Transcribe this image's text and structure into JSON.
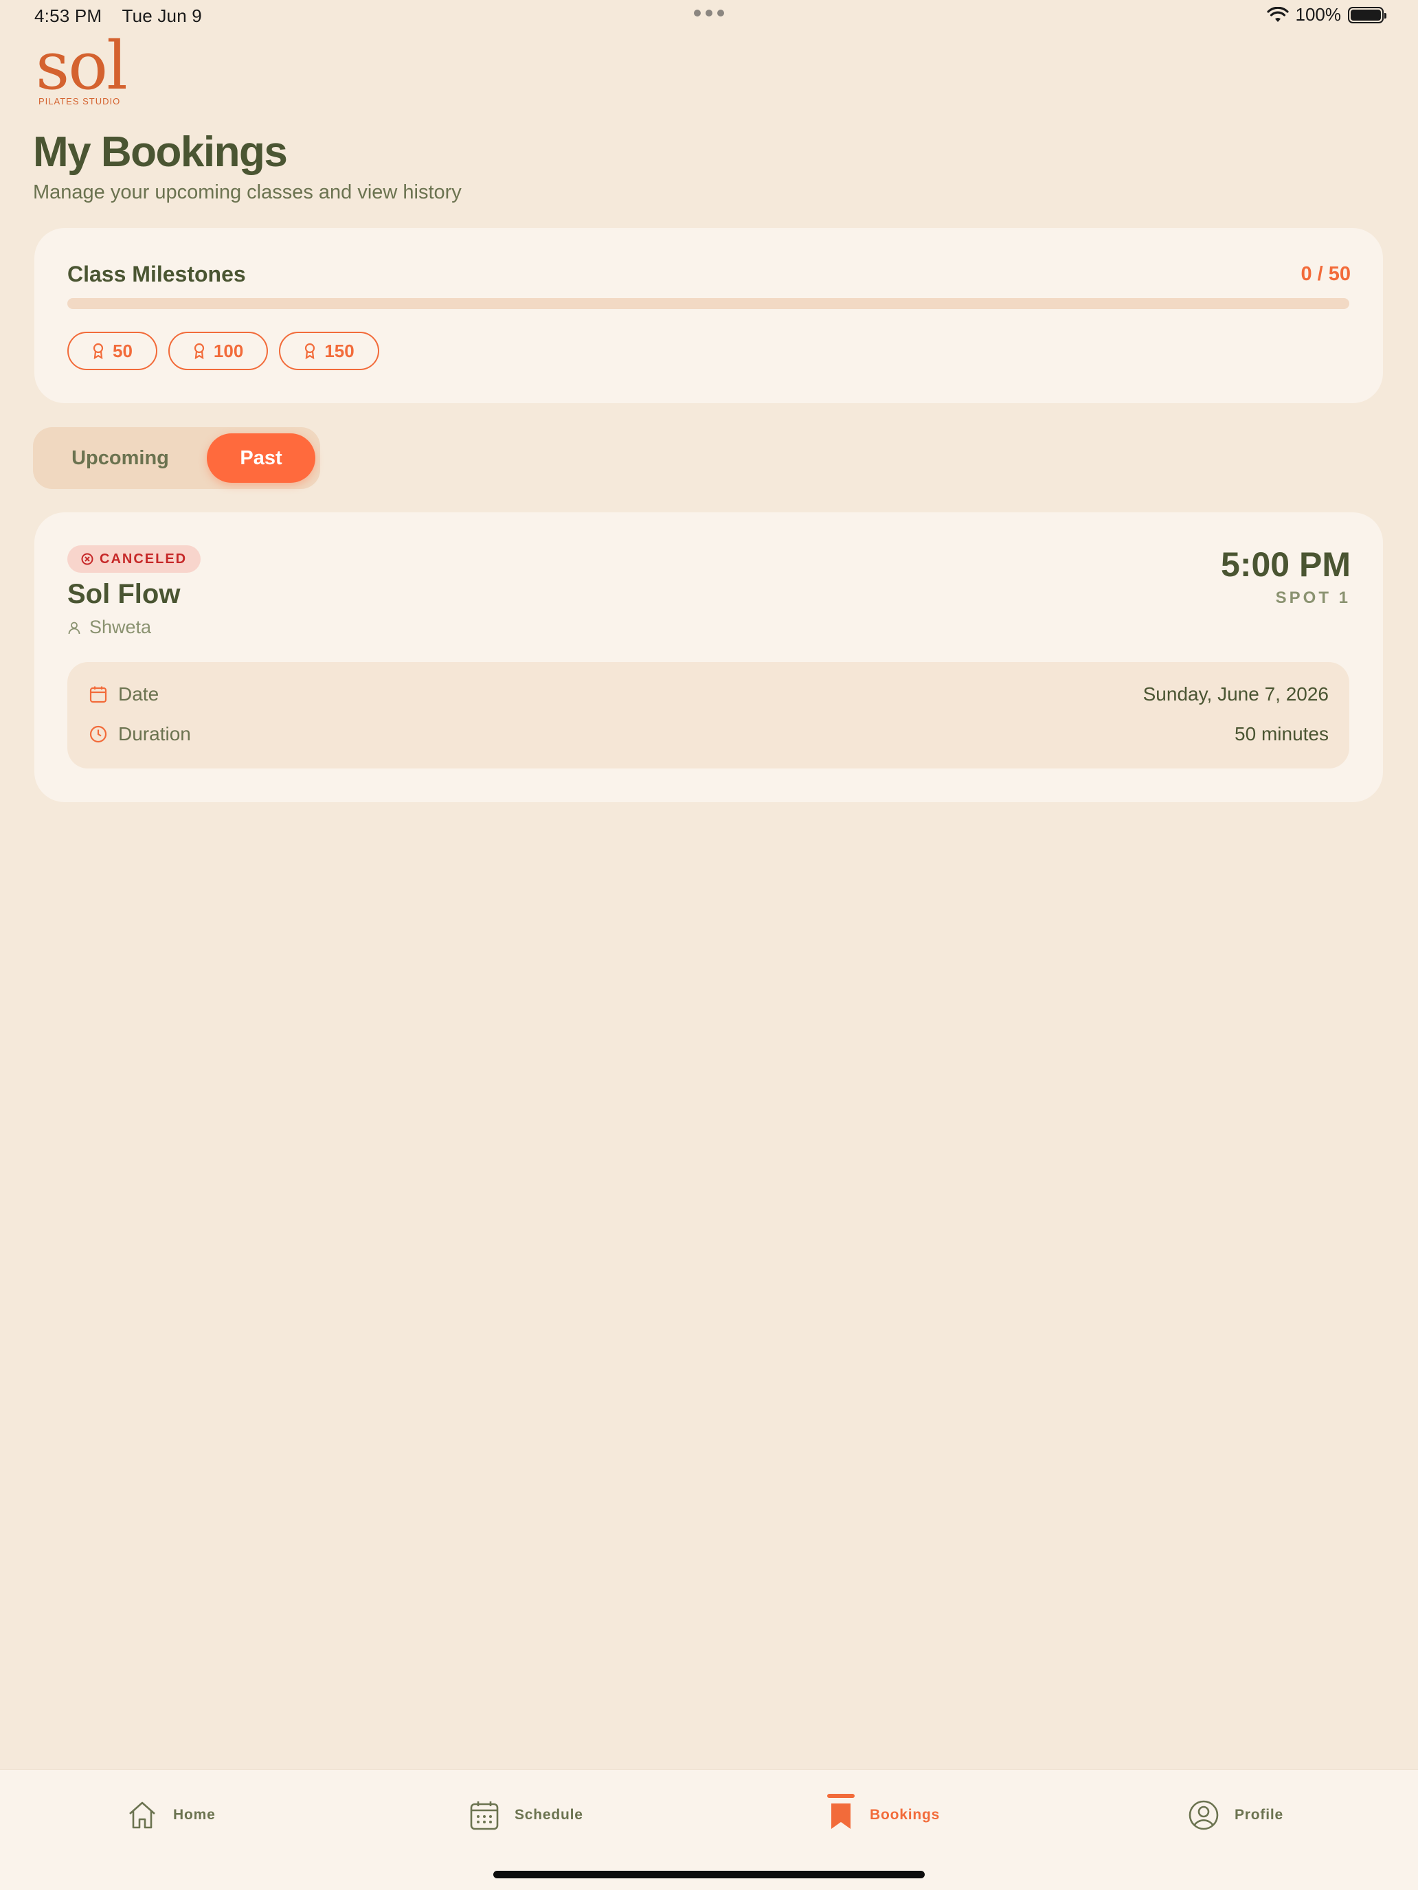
{
  "status_bar": {
    "time": "4:53 PM",
    "date": "Tue Jun 9",
    "battery": "100%"
  },
  "brand": {
    "name": "sol",
    "subtitle": "PILATES STUDIO",
    "accent_color": "#F26B3A"
  },
  "header": {
    "title": "My Bookings",
    "subtitle": "Manage your upcoming classes and view history"
  },
  "milestones": {
    "title": "Class Milestones",
    "count_label": "0 / 50",
    "progress": 0,
    "badges": [
      "50",
      "100",
      "150"
    ]
  },
  "segments": {
    "upcoming": "Upcoming",
    "past": "Past",
    "selected": "past"
  },
  "booking": {
    "status": "CANCELED",
    "status_color": "#C62828",
    "class_name": "Sol Flow",
    "instructor": "Shweta",
    "time": "5:00 PM",
    "spot": "SPOT 1",
    "date_label": "Date",
    "date_value": "Sunday, June 7, 2026",
    "duration_label": "Duration",
    "duration_value": "50 minutes"
  },
  "tabs": [
    {
      "label": "Home",
      "icon": "house-icon"
    },
    {
      "label": "Schedule",
      "icon": "calendar-icon"
    },
    {
      "label": "Bookings",
      "icon": "bookmark-icon",
      "active": true
    },
    {
      "label": "Profile",
      "icon": "user-circle-icon"
    }
  ]
}
